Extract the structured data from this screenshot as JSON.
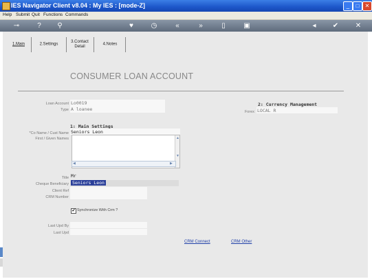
{
  "window": {
    "title": "IES Navigator Client v8.04 : My IES :      [mode-Z]"
  },
  "window_buttons": {
    "minimize": "_",
    "maximize": "□",
    "close": "✕"
  },
  "menu": [
    "Help",
    "Submit",
    "Quit",
    "Functions",
    "Commands"
  ],
  "toolbar": {
    "icons": [
      "key-icon",
      "help-icon",
      "search-icon",
      "heart-icon",
      "clock-icon",
      "rewind-icon",
      "fast-forward-icon",
      "list-icon",
      "settings-icon",
      "back-icon",
      "check-icon",
      "close-icon"
    ],
    "glyphs": [
      "⊸",
      "?",
      "⚲",
      "♥",
      "◷",
      "«",
      "»",
      "▯",
      "▣",
      "◂",
      "✔",
      "✕"
    ]
  },
  "tabs": [
    {
      "label": "1.Main"
    },
    {
      "label": "2.Settings"
    },
    {
      "label": "3.Contact\nDetail"
    },
    {
      "label": "4.Notes"
    }
  ],
  "heading": "CONSUMER LOAN ACCOUNT",
  "loan": {
    "account_label": "Loan Account",
    "account_value": "Lo0019",
    "type_label": "Type",
    "type_value": "A loanee"
  },
  "main_settings": {
    "title": "1: Main Settings",
    "co_name_label": "*Co Name / Cust Name",
    "co_name_value": "Seniors Leon",
    "first_names_label": "First / Given Names",
    "title_label": "Title",
    "title_value": "Mr",
    "cheque_label": "Cheque Beneficiary",
    "cheque_value": "Seniors Leon",
    "client_ref_label": "Client Ref",
    "crm_number_label": "CRM Number",
    "sync_label": "Synchronize With Crm ?",
    "sync_checked": true,
    "last_upd_by_label": "Last Upd By",
    "last_upd_label": "Last Upd"
  },
  "currency": {
    "title": "2: Currency Management",
    "forex_label": "Forex",
    "forex_value": "LOCAL R"
  },
  "links": {
    "crm_connect": "CRM Connect",
    "crm_other": "CRM Other"
  }
}
